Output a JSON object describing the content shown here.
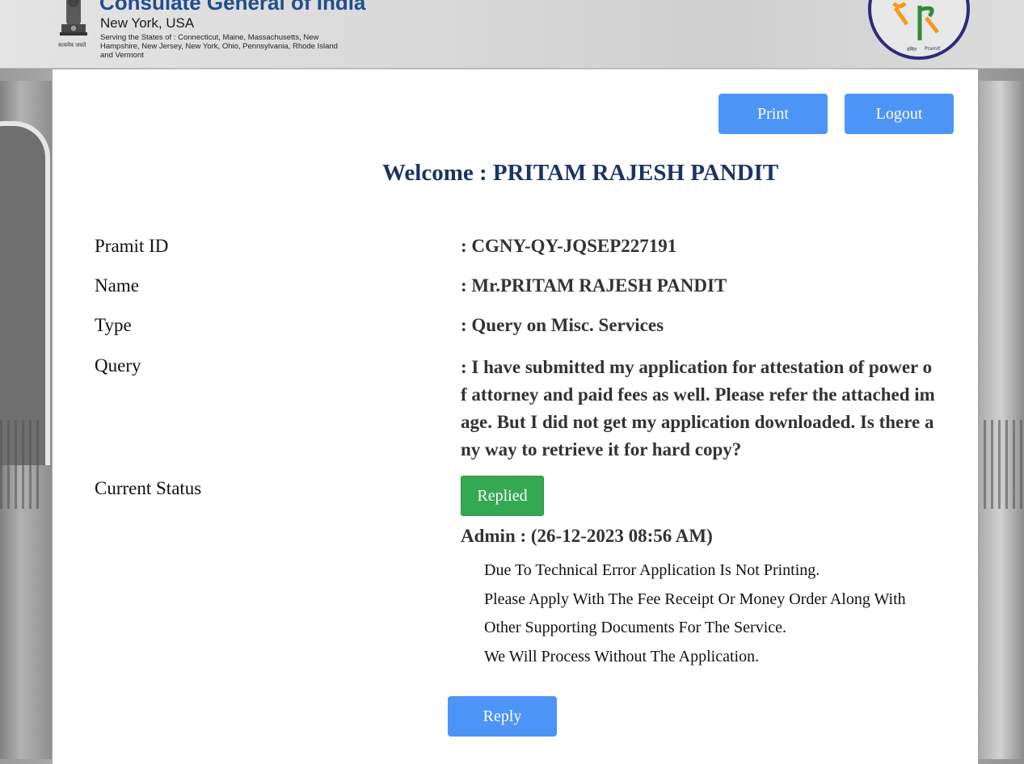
{
  "header": {
    "title": "Consulate General of India",
    "location": "New York, USA",
    "states": "Serving the States of : Connecticut, Maine, Massachusetts, New Hampshire, New Jersey, New York, Ohio, Pennsylvania, Rhode Island and Vermont",
    "emblem_caption": "सत्यमेव जयते",
    "logo_text_hi": "प्रमित",
    "logo_text_en": "Pramit"
  },
  "toolbar": {
    "print_label": "Print",
    "logout_label": "Logout"
  },
  "welcome": "Welcome : PRITAM RAJESH PANDIT",
  "details": {
    "pramit_id_label": "Pramit ID",
    "pramit_id_value": ": CGNY-QY-JQSEP227191",
    "name_label": "Name",
    "name_value": ": Mr.PRITAM RAJESH PANDIT",
    "type_label": "Type",
    "type_value": ": Query on Misc. Services",
    "query_label": "Query",
    "query_value": ": I have submitted my application for attestation of power of attorney and paid fees as well. Please refer the attached image. But I did not get my application downloaded. Is there any way to retrieve it for hard copy?",
    "status_label": "Current Status",
    "status_value": "Replied"
  },
  "reply": {
    "author_line": "Admin : (26-12-2023 08:56 AM)",
    "lines": [
      "Due To Technical Error Application Is Not Printing.",
      "Please Apply With The Fee Receipt Or Money Order Along With Other Supporting Documents For The Service.",
      "We Will Process Without The Application."
    ]
  },
  "actions": {
    "reply_label": "Reply"
  },
  "colors": {
    "primary_button": "#4d94f7",
    "status_green": "#34a853",
    "welcome_navy": "#1c3464",
    "header_title_blue": "#1f4e8f"
  }
}
